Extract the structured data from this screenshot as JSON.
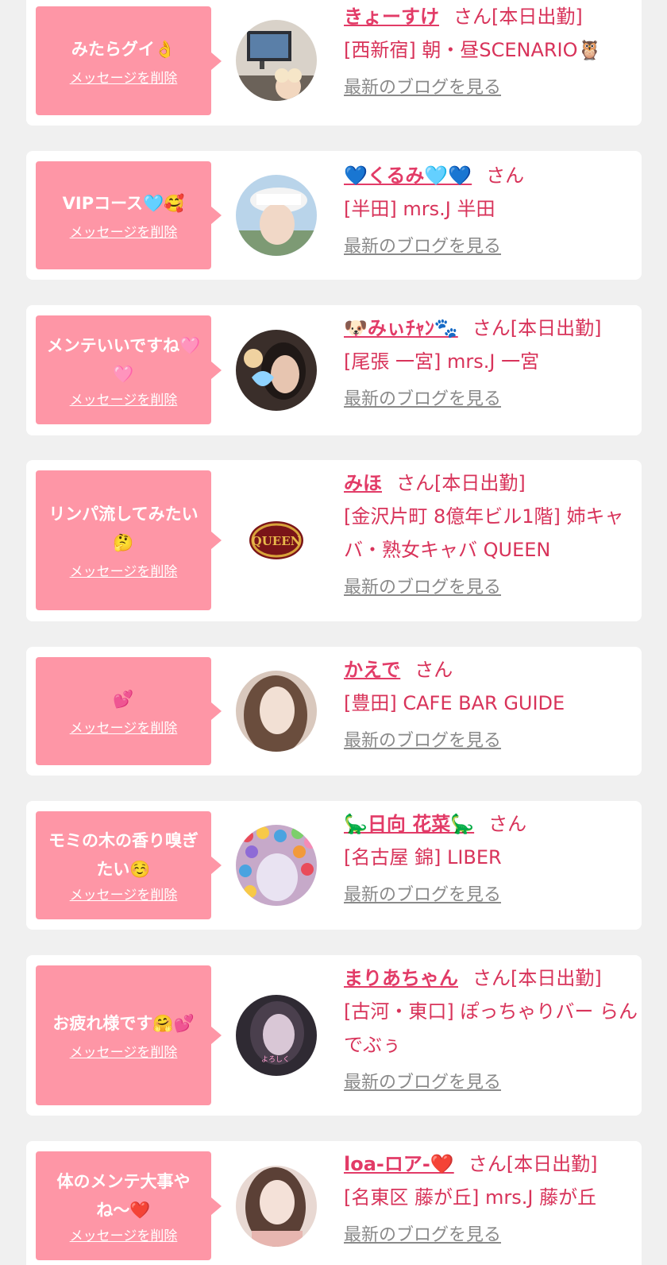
{
  "delete_label": "メッセージを削除",
  "blog_label": "最新のブログを見る",
  "colors": {
    "bubble": "#fe96a6",
    "name": "#e23b67",
    "text": "#d8335a",
    "link_gray": "#8a8a8a",
    "background": "#f0f0f0"
  },
  "items": [
    {
      "message": "みたらグイ👌",
      "name": "きょーすけ",
      "suffix": "さん[本日出勤]",
      "shop": "[西新宿] 朝・昼SCENARIO🦉",
      "avatar": "photo: office with monitors and person"
    },
    {
      "message": "VIPコース🩵🥰",
      "name": "💙⁣くるみ🩵💙",
      "suffix": "さん",
      "shop": "[半田] mrs.J 半田",
      "avatar": "photo: woman in white cap"
    },
    {
      "message": "メンテいいですね🩷🩷",
      "name": "🐶みぃﾁｬﾝ🐾",
      "suffix": "さん[本日出勤]",
      "shop": "[尾張 一宮] mrs.J 一宮",
      "avatar": "photo: woman with heart sticker"
    },
    {
      "message": "リンパ流してみたい🤔",
      "name": "みほ",
      "suffix": "さん[本日出勤]",
      "shop": "[金沢片町 8億年ビル1階] 姉キャバ・熟女キャバ QUEEN",
      "avatar": "logo: QUEEN"
    },
    {
      "message": "💕",
      "name": "かえで",
      "suffix": "さん",
      "shop": "[豊田] CAFE BAR GUIDE",
      "avatar": "photo: woman with long hair"
    },
    {
      "message": "モミの木の香り嗅ぎたい☺️",
      "name": "🦕日向 花菜🦕",
      "suffix": "さん",
      "shop": "[名古屋 錦] LIBER",
      "avatar": "photo: ball pit"
    },
    {
      "message": "お疲れ様です🤗💕",
      "name": "まりあちゃん",
      "suffix": "さん[本日出勤]",
      "shop": "[古河・東口] ぽっちゃりバー らんでぶぅ",
      "avatar": "photo: woman with stickers"
    },
    {
      "message": "体のメンテ大事やね〜❤️",
      "name": "loa-ロア-❤️",
      "suffix": "さん[本日出勤]",
      "shop": "[名東区 藤が丘] mrs.J 藤が丘",
      "avatar": "photo: woman portrait"
    }
  ]
}
